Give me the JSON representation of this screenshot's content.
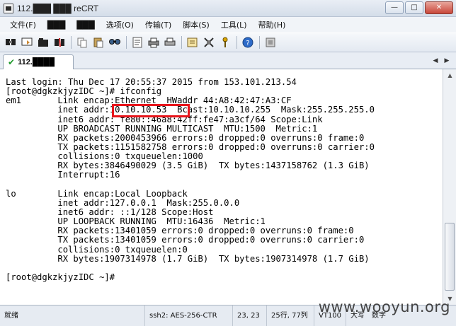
{
  "window": {
    "title": "112.███ ███ reCRT",
    "min_label": "—",
    "max_label": "□",
    "close_label": "✕"
  },
  "menu": {
    "items": [
      "文件(F)",
      "███",
      "███",
      "选项(O)",
      "传输(T)",
      "脚本(S)",
      "工具(L)",
      "帮助(H)"
    ]
  },
  "toolbar": {
    "icons": [
      "connect-icon",
      "quick-connect-icon",
      "tab-icon",
      "disconnect-icon",
      "copy-icon",
      "paste-icon",
      "find-icon",
      "print-setup-icon",
      "print-icon",
      "print-screen-icon",
      "session-options-icon",
      "keymap-icon",
      "key-icon",
      "help-icon",
      "sftp-icon"
    ]
  },
  "tab": {
    "label": "112.████",
    "status_icon": "✔"
  },
  "terminal": {
    "lines": [
      "Last login: Thu Dec 17 20:55:37 2015 from 153.101.213.54",
      "[root@dgkzkjyzIDC ~]# ifconfig",
      "em1       Link encap:Ethernet  HWaddr 44:A8:42:47:A3:CF",
      "          inet addr:10.10.10.53  Bcast:10.10.10.255  Mask:255.255.255.0",
      "          inet6 addr: fe80::46a8:42ff:fe47:a3cf/64 Scope:Link",
      "          UP BROADCAST RUNNING MULTICAST  MTU:1500  Metric:1",
      "          RX packets:2000453966 errors:0 dropped:0 overruns:0 frame:0",
      "          TX packets:1151582758 errors:0 dropped:0 overruns:0 carrier:0",
      "          collisions:0 txqueuelen:1000",
      "          RX bytes:3846490029 (3.5 GiB)  TX bytes:1437158762 (1.3 GiB)",
      "          Interrupt:16",
      "",
      "lo        Link encap:Local Loopback",
      "          inet addr:127.0.0.1  Mask:255.0.0.0",
      "          inet6 addr: ::1/128 Scope:Host",
      "          UP LOOPBACK RUNNING  MTU:16436  Metric:1",
      "          RX packets:13401059 errors:0 dropped:0 overruns:0 frame:0",
      "          TX packets:13401059 errors:0 dropped:0 overruns:0 carrier:0",
      "          collisions:0 txqueuelen:0",
      "          RX bytes:1907314978 (1.7 GiB)  TX bytes:1907314978 (1.7 GiB)",
      "",
      "[root@dgkzkjyzIDC ~]#"
    ],
    "highlight_color": "#e8151b"
  },
  "status": {
    "ready": "就绪",
    "protocol": "ssh2: AES-256-CTR",
    "cursor": "23,  23",
    "size": "25行, 77列",
    "terminal_type": "VT100",
    "caps": "大写",
    "num": "数字"
  },
  "watermark": "www.wooyun.org"
}
